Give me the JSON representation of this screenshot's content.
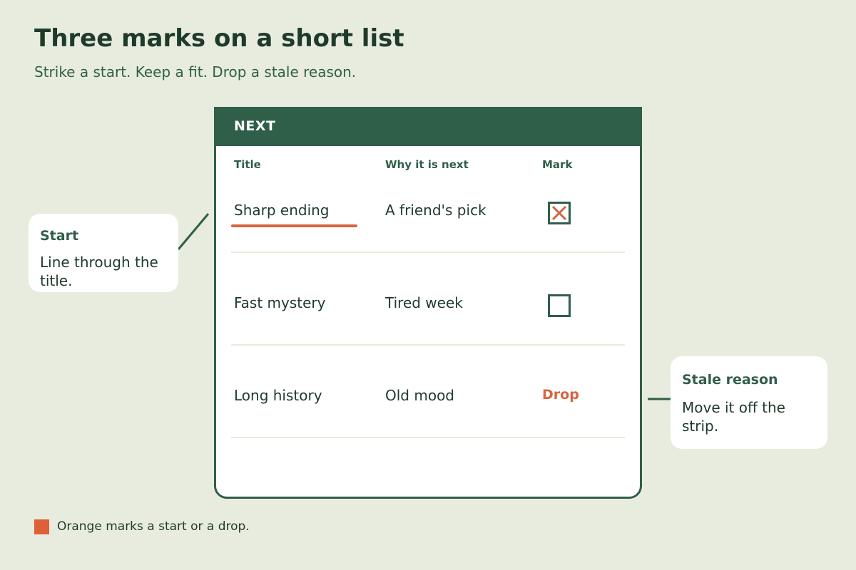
{
  "header": {
    "title": "Three marks on a short list",
    "subtitle": "Strike a start. Keep a fit. Drop a stale reason."
  },
  "card": {
    "heading": "NEXT",
    "columns": [
      "Title",
      "Why it is next",
      "Mark"
    ],
    "rows": [
      {
        "title": "Sharp ending",
        "reason": "A friend's pick",
        "mark": "checked-x",
        "title_struck": true
      },
      {
        "title": "Fast mystery",
        "reason": "Tired week",
        "mark": "empty-box",
        "title_struck": false
      },
      {
        "title": "Long history",
        "reason": "Old mood",
        "mark": "Drop",
        "title_struck": false
      }
    ]
  },
  "callouts": {
    "start": {
      "title": "Start",
      "body": "Line through the title."
    },
    "stale": {
      "title": "Stale reason",
      "body": "Move it off the strip."
    }
  },
  "legend": {
    "text": "Orange marks a start or a drop."
  },
  "colors": {
    "background": "#e8ecdf",
    "green": "#2f5e49",
    "orange": "#d5653f",
    "card": "#ffffff"
  }
}
